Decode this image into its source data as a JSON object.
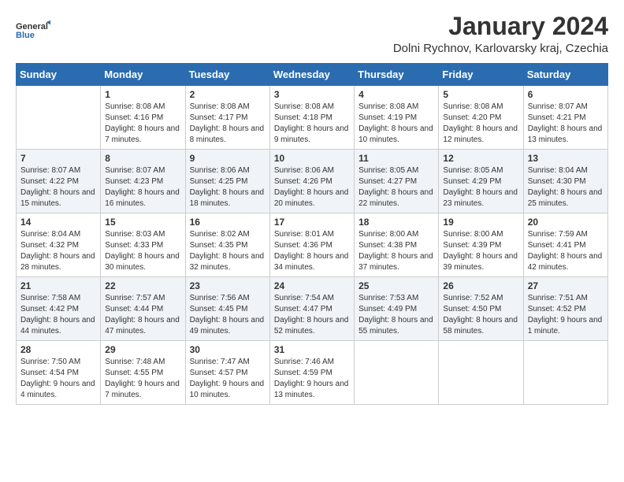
{
  "header": {
    "logo_general": "General",
    "logo_blue": "Blue",
    "month_title": "January 2024",
    "subtitle": "Dolni Rychnov, Karlovarsky kraj, Czechia"
  },
  "days_of_week": [
    "Sunday",
    "Monday",
    "Tuesday",
    "Wednesday",
    "Thursday",
    "Friday",
    "Saturday"
  ],
  "weeks": [
    [
      {
        "num": "",
        "sunrise": "",
        "sunset": "",
        "daylight": ""
      },
      {
        "num": "1",
        "sunrise": "Sunrise: 8:08 AM",
        "sunset": "Sunset: 4:16 PM",
        "daylight": "Daylight: 8 hours and 7 minutes."
      },
      {
        "num": "2",
        "sunrise": "Sunrise: 8:08 AM",
        "sunset": "Sunset: 4:17 PM",
        "daylight": "Daylight: 8 hours and 8 minutes."
      },
      {
        "num": "3",
        "sunrise": "Sunrise: 8:08 AM",
        "sunset": "Sunset: 4:18 PM",
        "daylight": "Daylight: 8 hours and 9 minutes."
      },
      {
        "num": "4",
        "sunrise": "Sunrise: 8:08 AM",
        "sunset": "Sunset: 4:19 PM",
        "daylight": "Daylight: 8 hours and 10 minutes."
      },
      {
        "num": "5",
        "sunrise": "Sunrise: 8:08 AM",
        "sunset": "Sunset: 4:20 PM",
        "daylight": "Daylight: 8 hours and 12 minutes."
      },
      {
        "num": "6",
        "sunrise": "Sunrise: 8:07 AM",
        "sunset": "Sunset: 4:21 PM",
        "daylight": "Daylight: 8 hours and 13 minutes."
      }
    ],
    [
      {
        "num": "7",
        "sunrise": "Sunrise: 8:07 AM",
        "sunset": "Sunset: 4:22 PM",
        "daylight": "Daylight: 8 hours and 15 minutes."
      },
      {
        "num": "8",
        "sunrise": "Sunrise: 8:07 AM",
        "sunset": "Sunset: 4:23 PM",
        "daylight": "Daylight: 8 hours and 16 minutes."
      },
      {
        "num": "9",
        "sunrise": "Sunrise: 8:06 AM",
        "sunset": "Sunset: 4:25 PM",
        "daylight": "Daylight: 8 hours and 18 minutes."
      },
      {
        "num": "10",
        "sunrise": "Sunrise: 8:06 AM",
        "sunset": "Sunset: 4:26 PM",
        "daylight": "Daylight: 8 hours and 20 minutes."
      },
      {
        "num": "11",
        "sunrise": "Sunrise: 8:05 AM",
        "sunset": "Sunset: 4:27 PM",
        "daylight": "Daylight: 8 hours and 22 minutes."
      },
      {
        "num": "12",
        "sunrise": "Sunrise: 8:05 AM",
        "sunset": "Sunset: 4:29 PM",
        "daylight": "Daylight: 8 hours and 23 minutes."
      },
      {
        "num": "13",
        "sunrise": "Sunrise: 8:04 AM",
        "sunset": "Sunset: 4:30 PM",
        "daylight": "Daylight: 8 hours and 25 minutes."
      }
    ],
    [
      {
        "num": "14",
        "sunrise": "Sunrise: 8:04 AM",
        "sunset": "Sunset: 4:32 PM",
        "daylight": "Daylight: 8 hours and 28 minutes."
      },
      {
        "num": "15",
        "sunrise": "Sunrise: 8:03 AM",
        "sunset": "Sunset: 4:33 PM",
        "daylight": "Daylight: 8 hours and 30 minutes."
      },
      {
        "num": "16",
        "sunrise": "Sunrise: 8:02 AM",
        "sunset": "Sunset: 4:35 PM",
        "daylight": "Daylight: 8 hours and 32 minutes."
      },
      {
        "num": "17",
        "sunrise": "Sunrise: 8:01 AM",
        "sunset": "Sunset: 4:36 PM",
        "daylight": "Daylight: 8 hours and 34 minutes."
      },
      {
        "num": "18",
        "sunrise": "Sunrise: 8:00 AM",
        "sunset": "Sunset: 4:38 PM",
        "daylight": "Daylight: 8 hours and 37 minutes."
      },
      {
        "num": "19",
        "sunrise": "Sunrise: 8:00 AM",
        "sunset": "Sunset: 4:39 PM",
        "daylight": "Daylight: 8 hours and 39 minutes."
      },
      {
        "num": "20",
        "sunrise": "Sunrise: 7:59 AM",
        "sunset": "Sunset: 4:41 PM",
        "daylight": "Daylight: 8 hours and 42 minutes."
      }
    ],
    [
      {
        "num": "21",
        "sunrise": "Sunrise: 7:58 AM",
        "sunset": "Sunset: 4:42 PM",
        "daylight": "Daylight: 8 hours and 44 minutes."
      },
      {
        "num": "22",
        "sunrise": "Sunrise: 7:57 AM",
        "sunset": "Sunset: 4:44 PM",
        "daylight": "Daylight: 8 hours and 47 minutes."
      },
      {
        "num": "23",
        "sunrise": "Sunrise: 7:56 AM",
        "sunset": "Sunset: 4:45 PM",
        "daylight": "Daylight: 8 hours and 49 minutes."
      },
      {
        "num": "24",
        "sunrise": "Sunrise: 7:54 AM",
        "sunset": "Sunset: 4:47 PM",
        "daylight": "Daylight: 8 hours and 52 minutes."
      },
      {
        "num": "25",
        "sunrise": "Sunrise: 7:53 AM",
        "sunset": "Sunset: 4:49 PM",
        "daylight": "Daylight: 8 hours and 55 minutes."
      },
      {
        "num": "26",
        "sunrise": "Sunrise: 7:52 AM",
        "sunset": "Sunset: 4:50 PM",
        "daylight": "Daylight: 8 hours and 58 minutes."
      },
      {
        "num": "27",
        "sunrise": "Sunrise: 7:51 AM",
        "sunset": "Sunset: 4:52 PM",
        "daylight": "Daylight: 9 hours and 1 minute."
      }
    ],
    [
      {
        "num": "28",
        "sunrise": "Sunrise: 7:50 AM",
        "sunset": "Sunset: 4:54 PM",
        "daylight": "Daylight: 9 hours and 4 minutes."
      },
      {
        "num": "29",
        "sunrise": "Sunrise: 7:48 AM",
        "sunset": "Sunset: 4:55 PM",
        "daylight": "Daylight: 9 hours and 7 minutes."
      },
      {
        "num": "30",
        "sunrise": "Sunrise: 7:47 AM",
        "sunset": "Sunset: 4:57 PM",
        "daylight": "Daylight: 9 hours and 10 minutes."
      },
      {
        "num": "31",
        "sunrise": "Sunrise: 7:46 AM",
        "sunset": "Sunset: 4:59 PM",
        "daylight": "Daylight: 9 hours and 13 minutes."
      },
      {
        "num": "",
        "sunrise": "",
        "sunset": "",
        "daylight": ""
      },
      {
        "num": "",
        "sunrise": "",
        "sunset": "",
        "daylight": ""
      },
      {
        "num": "",
        "sunrise": "",
        "sunset": "",
        "daylight": ""
      }
    ]
  ]
}
